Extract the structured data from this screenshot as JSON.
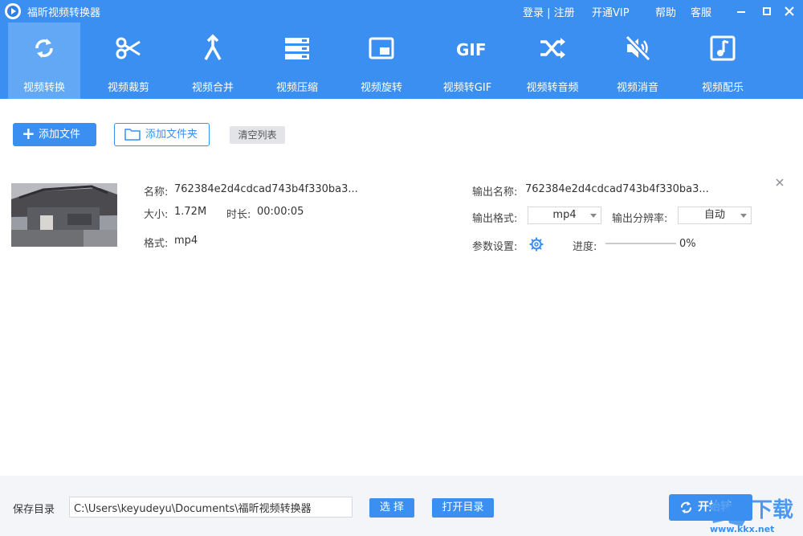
{
  "app": {
    "title": "福昕视频转换器"
  },
  "topbar": {
    "login": "登录 | 注册",
    "vip": "开通VIP",
    "help": "帮助",
    "service": "客服"
  },
  "toolbar": {
    "items": [
      {
        "label": "视频转换",
        "icon": "convert-icon",
        "active": true
      },
      {
        "label": "视频裁剪",
        "icon": "scissors-icon"
      },
      {
        "label": "视频合并",
        "icon": "merge-icon"
      },
      {
        "label": "视频压缩",
        "icon": "compress-icon"
      },
      {
        "label": "视频旋转",
        "icon": "rotate-icon"
      },
      {
        "label": "视频转GIF",
        "icon": "gif-icon",
        "icon_text": "GIF"
      },
      {
        "label": "视频转音频",
        "icon": "shuffle-icon"
      },
      {
        "label": "视频消音",
        "icon": "mute-icon"
      },
      {
        "label": "视频配乐",
        "icon": "music-icon"
      }
    ]
  },
  "actions": {
    "add_file": "添加文件",
    "add_folder": "添加文件夹",
    "clear_list": "清空列表"
  },
  "file": {
    "name_label": "名称:",
    "name": "762384e2d4cdcad743b4f330ba3...",
    "size_label": "大小:",
    "size": "1.72M",
    "duration_label": "时长:",
    "duration": "00:00:05",
    "format_label": "格式:",
    "format": "mp4",
    "output_name_label": "输出名称:",
    "output_name": "762384e2d4cdcad743b4f330ba3...",
    "output_format_label": "输出格式:",
    "output_format": "mp4",
    "resolution_label": "输出分辨率:",
    "resolution": "自动",
    "settings_label": "参数设置:",
    "progress_label": "进度:",
    "progress_text": "0%",
    "progress": 0
  },
  "footer": {
    "save_dir_label": "保存目录",
    "save_path": "C:\\Users\\keyudeyu\\Documents\\福昕视频转换器",
    "choose": "选 择",
    "open_dir": "打开目录",
    "start": "开始转"
  },
  "watermark": {
    "main": "下载",
    "site": "www.kkx.net"
  },
  "colors": {
    "primary": "#3b8ff0",
    "active_tab": "#62a8f5"
  }
}
